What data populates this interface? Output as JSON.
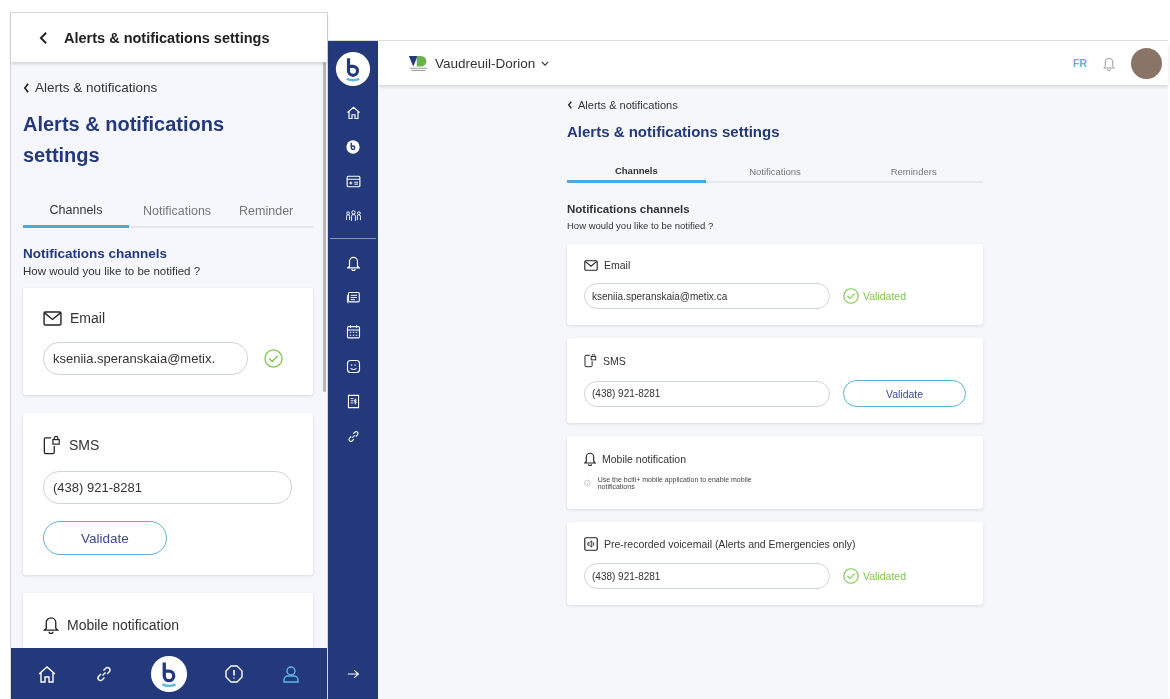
{
  "mobile": {
    "header_title": "Alerts & notifications settings",
    "back_link": "Alerts & notifications",
    "title": "Alerts & notifications settings",
    "tabs": [
      {
        "label": "Channels",
        "selected": true
      },
      {
        "label": "Notifications",
        "selected": false
      },
      {
        "label": "Reminder",
        "selected": false
      }
    ],
    "section_title": "Notifications channels",
    "section_subtitle": "How would you like to be notified ?",
    "channels": [
      {
        "kind": "email",
        "label": "Email",
        "value": "kseniia.speranskaia@metix.",
        "validated": true
      },
      {
        "kind": "sms",
        "label": "SMS",
        "value": "(438) 921-8281",
        "validated": false,
        "button": "Validate"
      },
      {
        "kind": "mobile",
        "label": "Mobile notification"
      }
    ]
  },
  "desktop": {
    "topbar": {
      "city": "Vaudreuil-Dorion",
      "language": "FR"
    },
    "back_link": "Alerts & notifications",
    "title": "Alerts & notifications settings",
    "tabs": [
      {
        "label": "Channels",
        "selected": true
      },
      {
        "label": "Notifications",
        "selected": false
      },
      {
        "label": "Reminders",
        "selected": false
      }
    ],
    "section_title": "Notifications channels",
    "section_subtitle": "How would you like to be notified ?",
    "channels": [
      {
        "kind": "email",
        "label": "Email",
        "value": "kseniia.speranskaia@metix.ca",
        "validated": true,
        "status_text": "Validated"
      },
      {
        "kind": "sms",
        "label": "SMS",
        "value": "(438) 921-8281",
        "validated": false,
        "button": "Validate"
      },
      {
        "kind": "mobile",
        "label": "Mobile notification",
        "note": "Use the bciti+ mobile application to enable mobile notifications"
      },
      {
        "kind": "voicemail",
        "label": "Pre-recorded voicemail (Alerts and Emergencies only)",
        "value": "(438) 921-8281",
        "validated": true,
        "status_text": "Validated"
      }
    ]
  }
}
